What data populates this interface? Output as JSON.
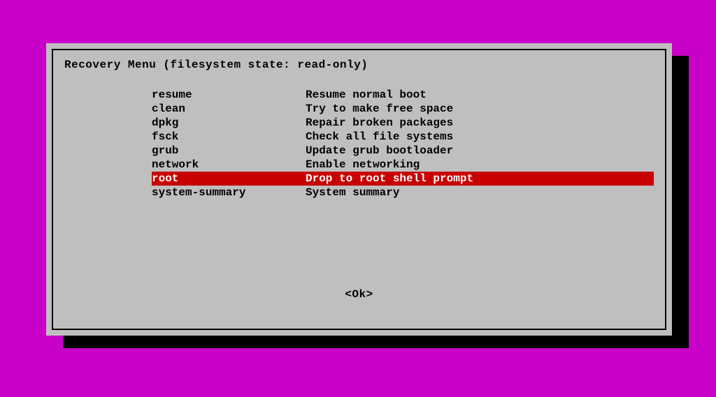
{
  "dialog": {
    "title": "Recovery Menu (filesystem state: read-only)",
    "ok_label": "<Ok>"
  },
  "menu": {
    "selected_index": 6,
    "items": [
      {
        "key": "resume",
        "desc": "Resume normal boot"
      },
      {
        "key": "clean",
        "desc": "Try to make free space"
      },
      {
        "key": "dpkg",
        "desc": "Repair broken packages"
      },
      {
        "key": "fsck",
        "desc": "Check all file systems"
      },
      {
        "key": "grub",
        "desc": "Update grub bootloader"
      },
      {
        "key": "network",
        "desc": "Enable networking"
      },
      {
        "key": "root",
        "desc": "Drop to root shell prompt"
      },
      {
        "key": "system-summary",
        "desc": "System summary"
      }
    ]
  }
}
